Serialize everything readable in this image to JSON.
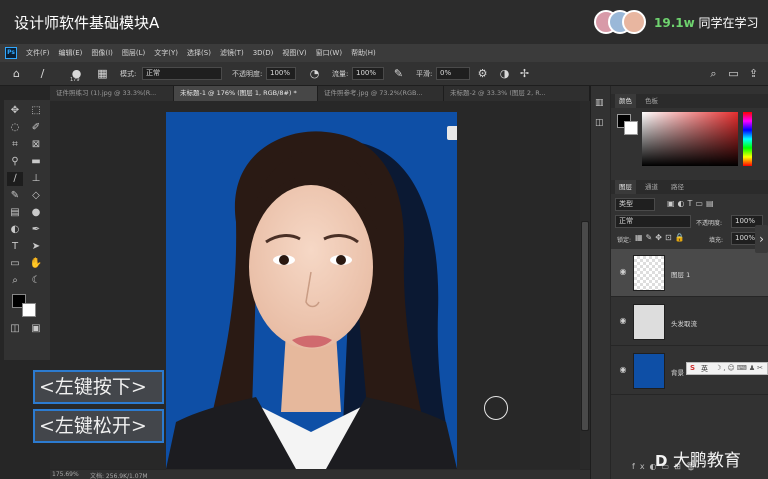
{
  "course": {
    "title": "设计师软件基础模块A",
    "viewer_count": "19.1w",
    "viewer_text": "同学在学习"
  },
  "app": {
    "logo": "Ps",
    "menu": [
      "文件(F)",
      "编辑(E)",
      "图像(I)",
      "图层(L)",
      "文字(Y)",
      "选择(S)",
      "滤镜(T)",
      "3D(D)",
      "视图(V)",
      "窗口(W)",
      "帮助(H)"
    ]
  },
  "options": {
    "brush_size": "179",
    "mode_label": "模式:",
    "mode_value": "正常",
    "opacity_label": "不透明度:",
    "opacity_value": "100%",
    "flow_label": "流量:",
    "flow_value": "100%",
    "smoothing_label": "平滑:",
    "smoothing_value": "0%"
  },
  "tabs": [
    {
      "label": "证件照练习 (1).jpg @ 33.3%(R...",
      "active": false
    },
    {
      "label": "未标题-1 @ 176% (图层 1, RGB/8#) *",
      "active": true
    },
    {
      "label": "证件照参考.jpg @ 73.2%(RGB...",
      "active": false
    },
    {
      "label": "未标题-2 @ 33.3% (图层 2, R...",
      "active": false
    }
  ],
  "overlay": {
    "left_press": "<左键按下>",
    "left_release": "<左键松开>"
  },
  "panels": {
    "color_tabs": [
      "颜色",
      "色板"
    ],
    "layer_tabs": [
      "图层",
      "通道",
      "路径"
    ],
    "filter_kind": "类型",
    "blend_mode": "正常",
    "opacity_label": "不透明度:",
    "opacity_value": "100%",
    "lock_label": "锁定:",
    "fill_label": "填充:",
    "fill_value": "100%",
    "layers": [
      {
        "name": "图层 1",
        "selected": true,
        "visible": true
      },
      {
        "name": "头发取流",
        "selected": false,
        "visible": true
      },
      {
        "name": "背景",
        "selected": false,
        "visible": true
      }
    ]
  },
  "ime": {
    "label": "英"
  },
  "status": {
    "zoom": "175.69%",
    "doc": "文档: 256.9K/1.07M"
  },
  "watermark": "大鹏教育",
  "colors": {
    "accent_green": "#6fd36f",
    "canvas_blue": "#0e4fa6",
    "overlay_border": "#2c7bd0"
  }
}
